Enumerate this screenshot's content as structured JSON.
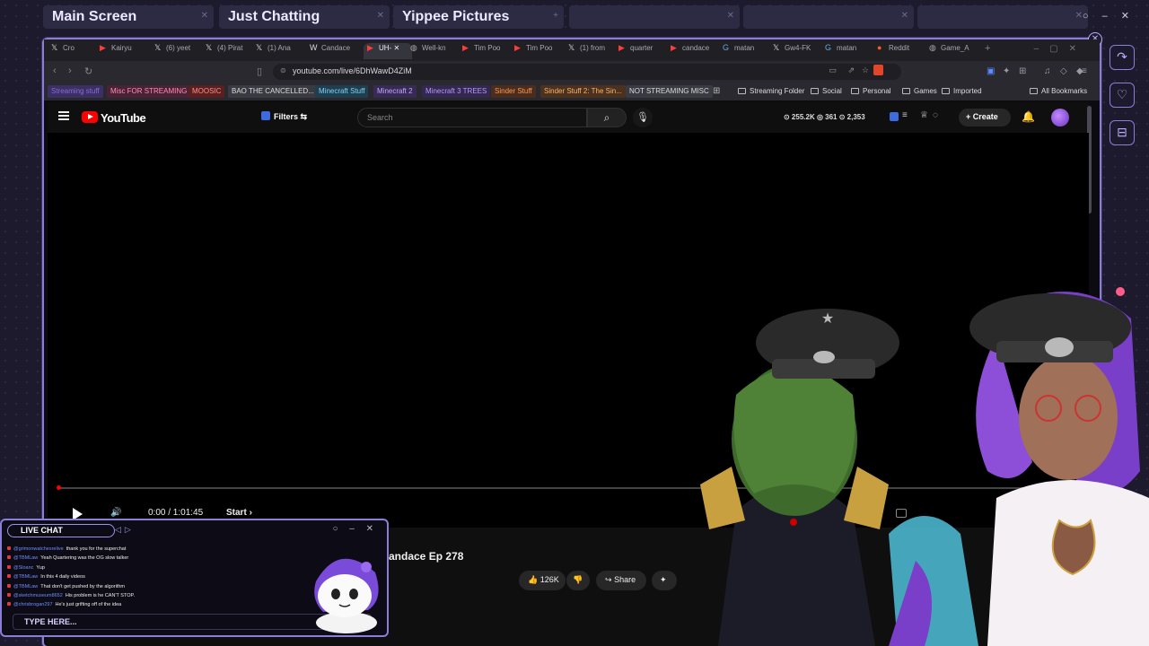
{
  "scenes": {
    "tabs": [
      {
        "label": "Main Screen"
      },
      {
        "label": "Just Chatting"
      },
      {
        "label": "Yippee Pictures"
      }
    ],
    "window_controls": "○ – ✕"
  },
  "browser": {
    "tabs": [
      {
        "icon": "x-icon",
        "label": "Cro"
      },
      {
        "icon": "youtube-icon",
        "label": "Kairyu"
      },
      {
        "icon": "x-icon",
        "label": "(6) yeet"
      },
      {
        "icon": "x-icon",
        "label": "(4) Pirat"
      },
      {
        "icon": "x-icon",
        "label": "(1) Ana"
      },
      {
        "icon": "w-icon",
        "label": "Candace"
      },
      {
        "icon": "youtube-icon",
        "label": "UH-"
      },
      {
        "icon": "globe-icon",
        "label": "Well-kn"
      },
      {
        "icon": "youtube-icon",
        "label": "Tim Poo"
      },
      {
        "icon": "youtube-icon",
        "label": "Tim Poo"
      },
      {
        "icon": "x-icon",
        "label": "(1) from"
      },
      {
        "icon": "youtube-icon",
        "label": "quarter"
      },
      {
        "icon": "youtube-icon",
        "label": "candace"
      },
      {
        "icon": "google-icon",
        "label": "matan"
      },
      {
        "icon": "x-icon",
        "label": "Gw4-FK"
      },
      {
        "icon": "google-icon",
        "label": "matan"
      },
      {
        "icon": "reddit-icon",
        "label": "Reddit"
      },
      {
        "icon": "globe-icon",
        "label": "Game_A"
      }
    ],
    "url": "youtube.com/live/6DhWawD4ZiM",
    "bookmarks": [
      {
        "label": "Streaming stuff",
        "color": "#8b6bd9",
        "bg": "#3b2f63"
      },
      {
        "label": "Misc FOR STREAMING",
        "color": "#ff8fb3",
        "bg": "#4a2236"
      },
      {
        "label": "MOOSIC",
        "color": "#ff8f8f",
        "bg": "#5a1f1f"
      },
      {
        "label": "BAO THE CANCELLED...",
        "color": "#dddddd",
        "bg": "#3a3a42"
      },
      {
        "label": "Minecraft Stuff",
        "color": "#7fd3ff",
        "bg": "#1f3f4f"
      },
      {
        "label": "Minecraft 2",
        "color": "#c6a6ff",
        "bg": "#372a55"
      },
      {
        "label": "Minecraft 3 TREES",
        "color": "#b796ff",
        "bg": "#33284f"
      },
      {
        "label": "Sinder Stuff",
        "color": "#ff9a55",
        "bg": "#4a2d1c"
      },
      {
        "label": "Sinder Stuff 2: The Sin...",
        "color": "#ffb36b",
        "bg": "#4a321f"
      },
      {
        "label": "NOT STREAMING MISC",
        "color": "#dddddd",
        "bg": "#3a3a42"
      }
    ],
    "bookmark_folders": [
      {
        "label": "Streaming Folder"
      },
      {
        "label": "Social"
      },
      {
        "label": "Personal"
      },
      {
        "label": "Games"
      },
      {
        "label": "Imported"
      }
    ],
    "all_bookmarks": "All Bookmarks"
  },
  "youtube": {
    "logo": "YouTube",
    "filters": "Filters",
    "search_placeholder": "Search",
    "stats": "⊙ 255.2K  ◎ 361  ⊙ 2,353",
    "create": "Create",
    "time": "0:00 / 1:01:45",
    "chapter": "Start",
    "title": "andace Ep 278",
    "likes": "126K",
    "share": "Share"
  },
  "chat": {
    "title": "LIVE CHAT",
    "lines": [
      {
        "user": "@grimonwatchesrelive",
        "text": "thank you for the superchat"
      },
      {
        "user": "@TBMLaw",
        "text": "Yeah Quartering was the OG slow talker"
      },
      {
        "user": "@Sloanc",
        "text": "Yup"
      },
      {
        "user": "@TBMLaw",
        "text": "In this 4 daily videos"
      },
      {
        "user": "@TBMLaw",
        "text": "That don't get pushed by the algorithm"
      },
      {
        "user": "@sketchmuseum8652",
        "text": "His problem is he CAN'T STOP."
      },
      {
        "user": "@chrisbrogan297",
        "text": "He's just grifting off of the idea"
      }
    ],
    "input_placeholder": "TYPE HERE...",
    "controls": "○ – ✕"
  }
}
